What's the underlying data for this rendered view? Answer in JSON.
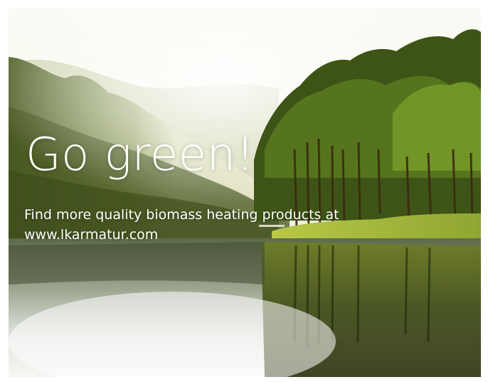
{
  "banner": {
    "headline": "Go green!",
    "tagline_line1": "Find more quality biomass heating products at",
    "tagline_line2": "www.lkarmatur.com"
  },
  "scene": {
    "description_icon": "forest-lake-photo"
  }
}
